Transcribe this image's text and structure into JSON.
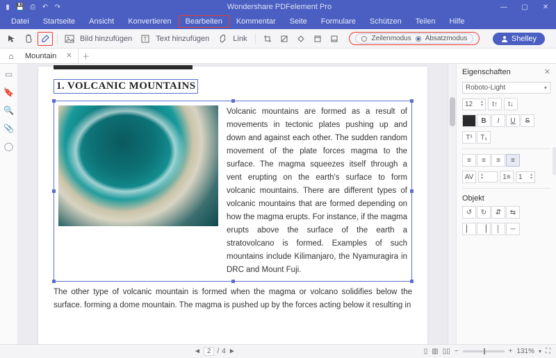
{
  "titlebar": {
    "title": "Wondershare PDFelement Pro"
  },
  "menu": {
    "items": [
      "Datei",
      "Startseite",
      "Ansicht",
      "Konvertieren",
      "Bearbeiten",
      "Kommentar",
      "Seite",
      "Formulare",
      "Schützen",
      "Teilen",
      "Hilfe"
    ],
    "highlighted_index": 4
  },
  "toolbar": {
    "add_image": "Bild hinzufügen",
    "add_text": "Text hinzufügen",
    "link": "Link",
    "mode_line": "Zeilenmodus",
    "mode_para": "Absatzmodus",
    "user": "Shelley"
  },
  "tabs": {
    "doc_name": "Mountain"
  },
  "document": {
    "heading": "1. VOLCANIC MOUNTAINS",
    "para1": "Volcanic mountains are formed as a result of movements in tectonic plates pushing up and down and against each other. The sudden random movement of the plate forces magma to the surface. The magma squeezes itself through a vent erupting on the earth's surface to form volcanic mountains. There are different types of volcanic mountains that are formed depending on how the magma erupts. For instance, if the magma erupts above the surface of the earth a stratovolcano is formed. Examples of such mountains include Kilimanjaro, the Nyamuragira in DRC and Mount Fuji. ",
    "para2": "The other type of volcanic mountain is formed when the magma or volcano solidifies below the surface. forming a dome mountain. The magma is pushed up by the forces acting below it resulting in"
  },
  "properties": {
    "title": "Eigenschaften",
    "font": "Roboto-Light",
    "size": "12",
    "object_label": "Objekt",
    "line_spacing": "1"
  },
  "status": {
    "page_current": "2",
    "page_total": "4",
    "zoom": "131%"
  }
}
